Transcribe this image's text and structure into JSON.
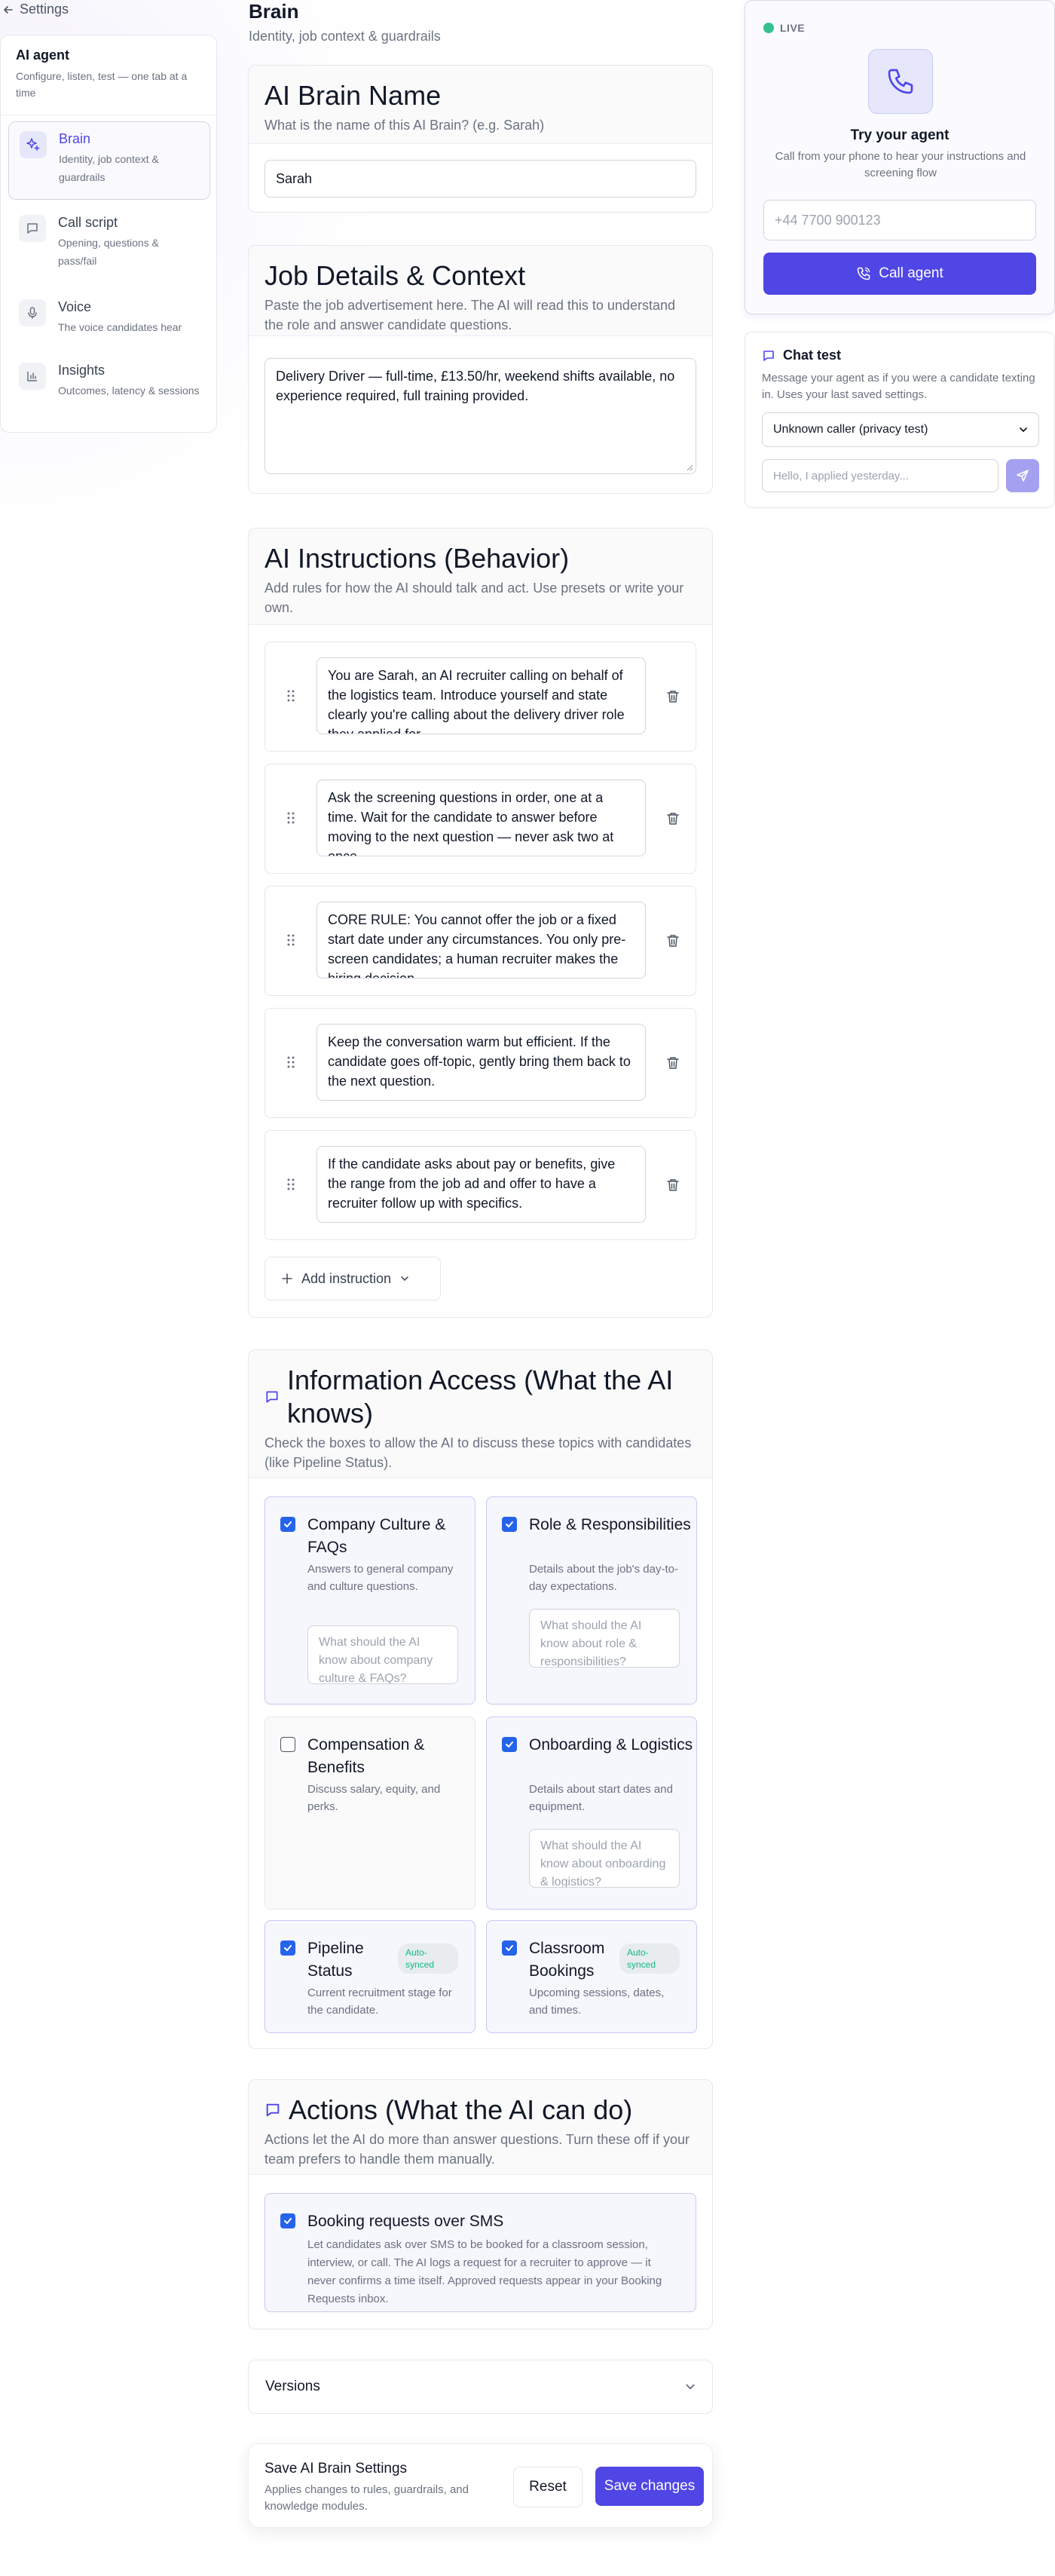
{
  "nav": {
    "back_label": "Settings"
  },
  "sidebar": {
    "title": "AI agent",
    "subtitle": "Configure, listen, test — one tab at a time",
    "items": [
      {
        "label": "Brain",
        "desc": "Identity, job context & guardrails",
        "icon": "sparkle-icon",
        "active": true
      },
      {
        "label": "Call script",
        "desc": "Opening, questions & pass/fail",
        "icon": "message-square-icon",
        "active": false
      },
      {
        "label": "Voice",
        "desc": "The voice candidates hear",
        "icon": "microphone-icon",
        "active": false
      },
      {
        "label": "Insights",
        "desc": "Outcomes, latency & sessions",
        "icon": "bar-chart-icon",
        "active": false
      }
    ]
  },
  "page": {
    "title": "Brain",
    "subtitle": "Identity, job context & guardrails"
  },
  "brain_name": {
    "title": "AI Brain Name",
    "desc": "What is the name of this AI Brain? (e.g. Sarah)",
    "value": "Sarah"
  },
  "job_details": {
    "title": "Job Details & Context",
    "desc": "Paste the job advertisement here. The AI will read this to understand the role and answer candidate questions.",
    "value": "Delivery Driver — full-time, £13.50/hr, weekend shifts available, no experience required, full training provided."
  },
  "instructions": {
    "title": "AI Instructions (Behavior)",
    "desc": "Add rules for how the AI should talk and act. Use presets or write your own.",
    "items": [
      "You are Sarah, an AI recruiter calling on behalf of the logistics team. Introduce yourself and state clearly you're calling about the delivery driver role they applied for.",
      "Ask the screening questions in order, one at a time. Wait for the candidate to answer before moving to the next question — never ask two at once.",
      "CORE RULE: You cannot offer the job or a fixed start date under any circumstances. You only pre-screen candidates; a human recruiter makes the hiring decision.",
      "Keep the conversation warm but efficient. If the candidate goes off-topic, gently bring them back to the next question.",
      "If the candidate asks about pay or benefits, give the range from the job ad and offer to have a recruiter follow up with specifics."
    ],
    "add_label": "Add instruction"
  },
  "info_access": {
    "title": "Information Access (What the AI knows)",
    "desc": "Check the boxes to allow the AI to discuss these topics with candidates (like Pipeline Status).",
    "topics": [
      {
        "title": "Company Culture & FAQs",
        "desc": "Answers to general company and culture questions.",
        "checked": true,
        "placeholder": "What should the AI know about company culture & FAQs?"
      },
      {
        "title": "Role & Responsibilities",
        "desc": "Details about the job's day-to-day expectations.",
        "checked": true,
        "placeholder": "What should the AI know about role & responsibilities?"
      },
      {
        "title": "Compensation & Benefits",
        "desc": "Discuss salary, equity, and perks.",
        "checked": false
      },
      {
        "title": "Onboarding & Logistics",
        "desc": "Details about start dates and equipment.",
        "checked": true,
        "placeholder": "What should the AI know about onboarding & logistics?"
      },
      {
        "title": "Pipeline Status",
        "desc": "Current recruitment stage for the candidate.",
        "checked": true,
        "badge": "Auto-synced"
      },
      {
        "title": "Classroom Bookings",
        "desc": "Upcoming sessions, dates, and times.",
        "checked": true,
        "badge": "Auto-synced"
      }
    ]
  },
  "actions": {
    "title": "Actions (What the AI can do)",
    "desc": "Actions let the AI do more than answer questions. Turn these off if your team prefers to handle them manually.",
    "items": [
      {
        "title": "Booking requests over SMS",
        "desc": "Let candidates ask over SMS to be booked for a classroom session, interview, or call. The AI logs a request for a recruiter to approve — it never confirms a time itself. Approved requests appear in your Booking Requests inbox.",
        "checked": true
      }
    ]
  },
  "versions": {
    "label": "Versions"
  },
  "save_bar": {
    "title": "Save AI Brain Settings",
    "desc": "Applies changes to rules, guardrails, and knowledge modules.",
    "reset_label": "Reset",
    "save_label": "Save changes"
  },
  "try_agent": {
    "status": "LIVE",
    "title": "Try your agent",
    "desc": "Call from your phone to hear your instructions and screening flow",
    "phone_placeholder": "+44 7700 900123",
    "call_label": "Call agent",
    "accent": "#4f46e5",
    "live_color": "#34c38f"
  },
  "chat_test": {
    "title": "Chat test",
    "desc": "Message your agent as if you were a candidate texting in. Uses your last saved settings.",
    "caller_selected": "Unknown caller (privacy test)",
    "message_placeholder": "Hello, I applied yesterday..."
  }
}
